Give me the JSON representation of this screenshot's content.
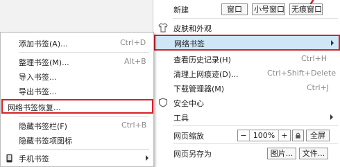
{
  "main_menu": {
    "new_label": "新建",
    "window_btn": "窗口",
    "small_window_btn": "小号窗口",
    "incognito_btn": "无痕窗口",
    "skin_label": "皮肤和外观",
    "bookmarks_label": "网络书签",
    "history_label": "查看历史记录(H)",
    "history_shortcut": "Ctrl+H",
    "clear_label": "清理上网痕迹(D)...",
    "clear_shortcut": "Ctrl+Shift+Delete",
    "downloads_label": "下载管理器(M)",
    "downloads_shortcut": "Ctrl+J",
    "security_label": "安全中心",
    "tools_label": "工具",
    "zoom_label": "网页缩放",
    "zoom_minus": "−",
    "zoom_value": "100%",
    "zoom_plus": "+",
    "fullscreen_btn": "全屏",
    "save_label": "网页另存为",
    "image_btn": "图片...",
    "file_btn": "文件..."
  },
  "bookmark_menu": {
    "add_label": "添加书签(A)...",
    "add_shortcut": "Ctrl+D",
    "organize_label": "整理书签(M)...",
    "organize_shortcut": "Alt+B",
    "import_label": "导入书签...",
    "export_label": "导出书签...",
    "restore_label": "网络书签恢复...",
    "hide_bar_label": "隐藏书签栏(F)",
    "hide_bar_shortcut": "Ctrl+B",
    "hide_icons_label": "隐藏书签项图标",
    "mobile_label": "手机书签"
  },
  "colors": {
    "highlight_bg": "#cfe6f7",
    "annotation_red": "#d62027"
  },
  "icons": [
    "shirt-icon",
    "shield-icon",
    "phone-icon",
    "lock-icon"
  ]
}
